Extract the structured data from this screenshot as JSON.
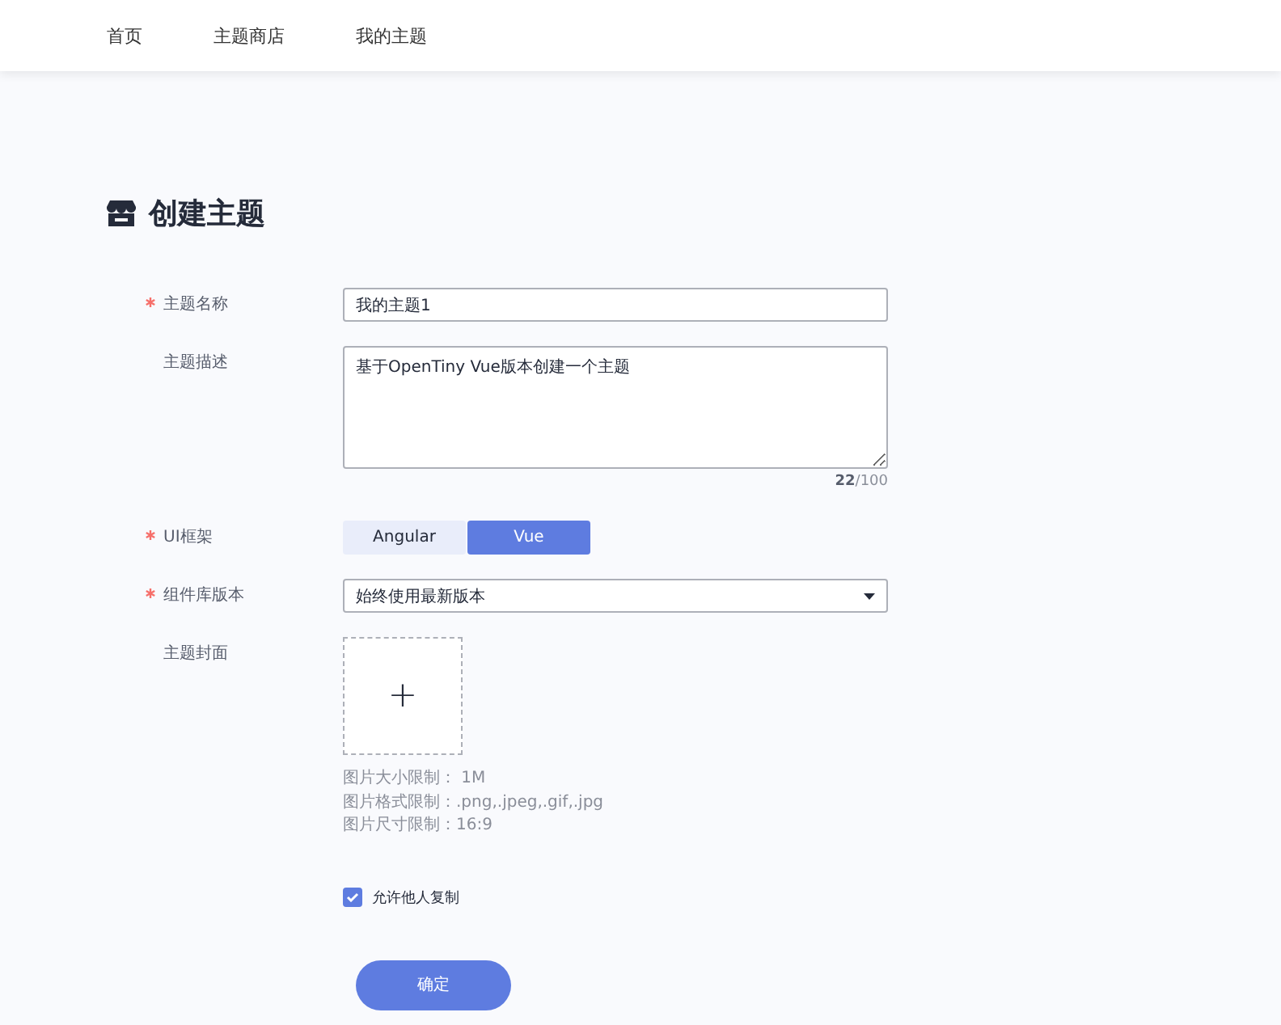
{
  "nav": [
    {
      "label": "首页",
      "selected": false
    },
    {
      "label": "主题商店",
      "selected": false
    },
    {
      "label": "我的主题",
      "selected": false
    }
  ],
  "title": "创建主题",
  "form": {
    "name": {
      "label": "主题名称",
      "required": true,
      "value": "我的主题1"
    },
    "description": {
      "label": "主题描述",
      "required": false,
      "value": "基于OpenTiny Vue版本创建一个主题",
      "count": "22",
      "max": "/100"
    },
    "framework": {
      "label": "UI框架",
      "required": true,
      "options": [
        {
          "label": "Angular",
          "selected": false
        },
        {
          "label": "Vue",
          "selected": true
        }
      ]
    },
    "version": {
      "label": "组件库版本",
      "required": true,
      "value": "始终使用最新版本"
    },
    "cover": {
      "label": "主题封面",
      "required": false,
      "upload_icon": "+",
      "hints": [
        "图片大小限制： 1M",
        "图片格式限制：.png,.jpeg,.gif,.jpg",
        "图片尺寸限制：16:9"
      ]
    },
    "allow_copy": {
      "label": "允许他人复制",
      "checked": true
    }
  },
  "submit": "确定"
}
